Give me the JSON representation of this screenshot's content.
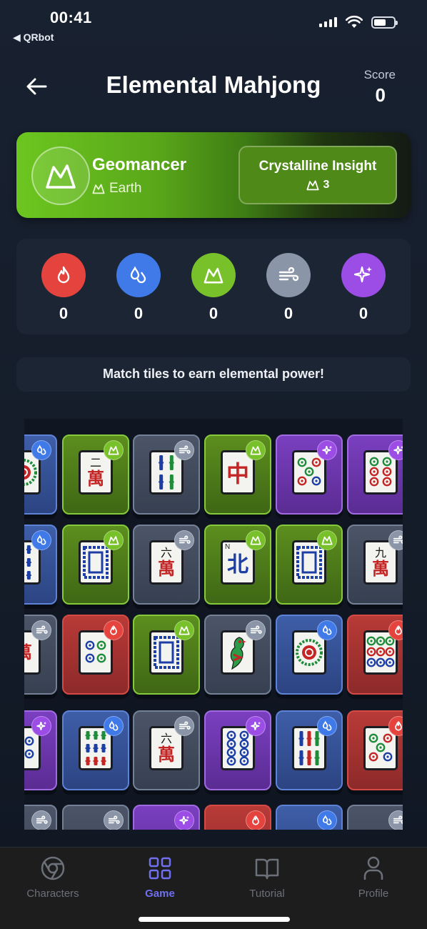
{
  "status_bar": {
    "time": "00:41",
    "back_app": "◀ QRbot"
  },
  "header": {
    "title": "Elemental Mahjong",
    "score_label": "Score",
    "score_value": "0"
  },
  "character": {
    "name": "Geomancer",
    "element": "Earth",
    "ability_name": "Crystalline Insight",
    "ability_cost": "3",
    "accent_color": "#6cc61f"
  },
  "elements": [
    {
      "name": "fire",
      "icon": "flame-icon",
      "color": "#e4443d",
      "count": "0"
    },
    {
      "name": "water",
      "icon": "droplet-icon",
      "color": "#3f7ae8",
      "count": "0"
    },
    {
      "name": "earth",
      "icon": "mountain-icon",
      "color": "#79c12a",
      "count": "0"
    },
    {
      "name": "air",
      "icon": "wind-icon",
      "color": "#8a95a8",
      "count": "0"
    },
    {
      "name": "spirit",
      "icon": "sparkle-icon",
      "color": "#9b4de6",
      "count": "0"
    }
  ],
  "message": "Match tiles to earn elemental power!",
  "board": {
    "rows": [
      [
        {
          "element": "water",
          "face": "dot-flower"
        },
        {
          "element": "earth",
          "face": "wan",
          "num": "二",
          "char": "萬"
        },
        {
          "element": "air",
          "face": "bamboo-3"
        },
        {
          "element": "earth",
          "face": "big-red",
          "char": "中"
        },
        {
          "element": "spirit",
          "face": "dots-5"
        },
        {
          "element": "spirit",
          "face": "dots-6"
        }
      ],
      [
        {
          "element": "water",
          "face": "bamboo-partial"
        },
        {
          "element": "earth",
          "face": "white-dragon"
        },
        {
          "element": "air",
          "face": "wan",
          "num": "六",
          "char": "萬"
        },
        {
          "element": "earth",
          "face": "big-blue",
          "char": "北",
          "corner": "N"
        },
        {
          "element": "earth",
          "face": "white-dragon"
        },
        {
          "element": "air",
          "face": "wan",
          "num": "九",
          "char": "萬"
        }
      ],
      [
        {
          "element": "air",
          "face": "wan-partial",
          "char": "萬"
        },
        {
          "element": "fire",
          "face": "dots-4"
        },
        {
          "element": "earth",
          "face": "white-dragon"
        },
        {
          "element": "air",
          "face": "bird"
        },
        {
          "element": "water",
          "face": "dot-flower"
        },
        {
          "element": "fire",
          "face": "dots-9"
        }
      ],
      [
        {
          "element": "spirit",
          "face": "dots-partial"
        },
        {
          "element": "water",
          "face": "bamboo-9"
        },
        {
          "element": "air",
          "face": "wan",
          "num": "六",
          "char": "萬"
        },
        {
          "element": "spirit",
          "face": "dots-8"
        },
        {
          "element": "water",
          "face": "bamboo-6"
        },
        {
          "element": "fire",
          "face": "dots-5"
        }
      ],
      [
        {
          "element": "air",
          "face": "none"
        },
        {
          "element": "air",
          "face": "none"
        },
        {
          "element": "spirit",
          "face": "none"
        },
        {
          "element": "fire",
          "face": "none"
        },
        {
          "element": "water",
          "face": "none"
        },
        {
          "element": "air",
          "face": "none"
        }
      ]
    ]
  },
  "tabs": [
    {
      "label": "Characters",
      "icon": "chrome-icon",
      "active": false
    },
    {
      "label": "Game",
      "icon": "grid-icon",
      "active": true
    },
    {
      "label": "Tutorial",
      "icon": "book-icon",
      "active": false
    },
    {
      "label": "Profile",
      "icon": "person-icon",
      "active": false
    }
  ]
}
